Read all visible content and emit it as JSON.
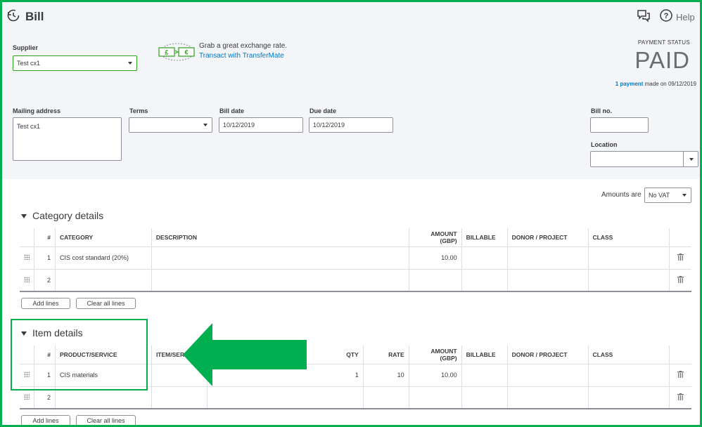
{
  "header": {
    "title": "Bill",
    "help_label": "Help"
  },
  "supplier": {
    "label": "Supplier",
    "value": "Test cx1"
  },
  "promo": {
    "text": "Grab a great exchange rate.",
    "link": "Transact with TransferMate"
  },
  "payment_status": {
    "label": "PAYMENT STATUS",
    "status": "PAID",
    "count_link": "1 payment",
    "suffix": "made on 09/12/2019"
  },
  "form": {
    "mailing_address_label": "Mailing address",
    "mailing_address_value": "Test cx1",
    "terms_label": "Terms",
    "terms_value": "",
    "bill_date_label": "Bill date",
    "bill_date_value": "10/12/2019",
    "due_date_label": "Due date",
    "due_date_value": "10/12/2019",
    "bill_no_label": "Bill no.",
    "bill_no_value": "",
    "location_label": "Location",
    "location_value": ""
  },
  "amounts": {
    "label": "Amounts are",
    "value": "No VAT"
  },
  "category_details": {
    "title": "Category details",
    "columns": [
      "#",
      "CATEGORY",
      "DESCRIPTION",
      "AMOUNT (GBP)",
      "BILLABLE",
      "DONOR / PROJECT",
      "CLASS"
    ],
    "rows": [
      {
        "num": "1",
        "category": "CIS cost standard (20%)",
        "description": "",
        "amount": "10.00"
      },
      {
        "num": "2",
        "category": "",
        "description": "",
        "amount": ""
      }
    ],
    "add_lines": "Add lines",
    "clear_lines": "Clear all lines"
  },
  "item_details": {
    "title": "Item details",
    "columns": [
      "#",
      "PRODUCT/SERVICE",
      "ITEM/SER",
      "QTY",
      "RATE",
      "AMOUNT (GBP)",
      "BILLABLE",
      "DONOR / PROJECT",
      "CLASS"
    ],
    "rows": [
      {
        "num": "1",
        "product": "CIS materials",
        "qty": "1",
        "rate": "10",
        "amount": "10.00"
      },
      {
        "num": "2",
        "product": "",
        "qty": "",
        "rate": "",
        "amount": ""
      }
    ],
    "add_lines": "Add lines",
    "clear_lines": "Clear all lines"
  },
  "colors": {
    "annotation_green": "#00b050",
    "field_green": "#2ca01c",
    "link_blue": "#0077c5"
  },
  "icons": [
    "history-icon",
    "chat-icon",
    "help-icon",
    "transfermate-icon",
    "drag-handle-icon",
    "trash-icon",
    "triangle-down-icon",
    "arrow-annotation"
  ]
}
